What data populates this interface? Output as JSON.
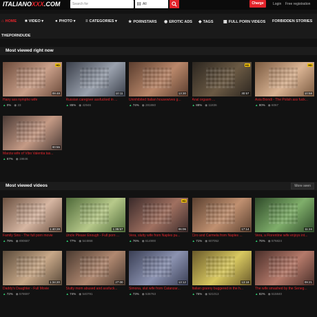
{
  "header": {
    "logo_main": "ITALIANO",
    "logo_accent": "XXX",
    "logo_tld": ".COM",
    "search_placeholder": "Search for",
    "scope_value": "All",
    "charge_label": "Charge",
    "login_label": "Login",
    "register_label": "Free registration"
  },
  "nav": {
    "items": [
      {
        "label": "HOME",
        "icon": "home-icon"
      },
      {
        "label": "VIDEO",
        "icon": "video-icon"
      },
      {
        "label": "PHOTO",
        "icon": "camera-icon"
      },
      {
        "label": "CATEGORIES",
        "icon": "list-icon"
      },
      {
        "label": "PORNSTARS",
        "icon": "star-icon"
      },
      {
        "label": "EROTIC ADS",
        "icon": "ads-icon"
      },
      {
        "label": "TAGS",
        "icon": "tag-icon"
      },
      {
        "label": "FULL PORN VIDEOS",
        "icon": "grid-icon"
      },
      {
        "label": "FORBIDDEN STORIES",
        "icon": ""
      }
    ],
    "second_row": "THEPORNDUDE"
  },
  "sections": {
    "most_viewed_now": "Most viewed right now",
    "most_viewed_videos": "Most viewed videos",
    "more_label": "More seen"
  },
  "now_videos": [
    {
      "title": "Hairy ass nympho wife",
      "rating": "0%",
      "views": "23",
      "duration": "09:48",
      "hd": "HD"
    },
    {
      "title": "Russian caregiver assfucked in ...",
      "rating": "85%",
      "views": "42946",
      "duration": "10:11",
      "hd": ""
    },
    {
      "title": "Uninhibited Italian housewives g...",
      "rating": "74%",
      "views": "281860",
      "duration": "13:30",
      "hd": ""
    },
    {
      "title": "Anal orgasm ...",
      "rating": "88%",
      "views": "11836",
      "duration": "30:57",
      "hd": "HD"
    },
    {
      "title": "Asia Biondi - The Polish ass fuck...",
      "rating": "90%",
      "views": "6067",
      "duration": "10:58",
      "hd": "HD"
    },
    {
      "title": "Marzia wife of Vibo Valentia tas...",
      "rating": "67%",
      "views": "19846",
      "duration": "00:55",
      "hd": ""
    }
  ],
  "top_videos": [
    {
      "title": "Family Sins - The full porn movie",
      "rating": "79%",
      "views": "890687",
      "duration": "1:40:28",
      "hd": ""
    },
    {
      "title": "Uncle Please Enough - Full porn ...",
      "rating": "77%",
      "views": "544868",
      "duration": "1:35:57",
      "hd": ""
    },
    {
      "title": "Vera, slutty wife from Naples pu...",
      "rating": "76%",
      "views": "614900",
      "duration": "06:06",
      "hd": "HD"
    },
    {
      "title": "Ciro and Carmela from Naples ...",
      "rating": "71%",
      "views": "607052",
      "duration": "17:14",
      "hd": ""
    },
    {
      "title": "Vera, a Florentine wife enjoys int...",
      "rating": "76%",
      "views": "576824",
      "duration": "11:24",
      "hd": ""
    },
    {
      "title": "Daddy's Daughter - Full Movie",
      "rating": "72%",
      "views": "578697",
      "duration": "1:34:20",
      "hd": ""
    },
    {
      "title": "Slutty mom abused and assfuck...",
      "rating": "74%",
      "views": "540791",
      "duration": "27:00",
      "hd": ""
    },
    {
      "title": "Simona, slut wife from Catanzar...",
      "rating": "73%",
      "views": "536763",
      "duration": "13:12",
      "hd": ""
    },
    {
      "title": "Italian granny buggered in the h...",
      "rating": "76%",
      "views": "521013",
      "duration": "13:18",
      "hd": ""
    },
    {
      "title": "The wife smashed by the Seneg...",
      "rating": "82%",
      "views": "515840",
      "duration": "09:21",
      "hd": ""
    }
  ]
}
